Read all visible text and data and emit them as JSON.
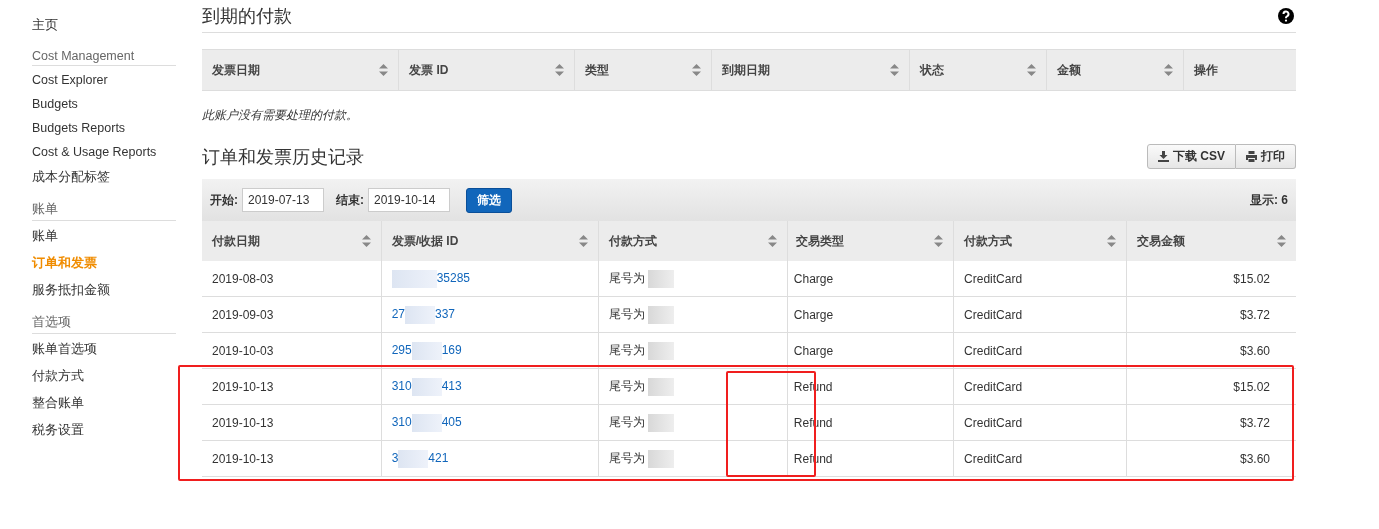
{
  "sidebar": {
    "sections": [
      {
        "items": [
          {
            "label": "主页",
            "selected": false
          }
        ]
      },
      {
        "heading": "Cost Management",
        "items": [
          {
            "label": "Cost Explorer",
            "selected": false
          },
          {
            "label": "Budgets",
            "selected": false
          },
          {
            "label": "Budgets Reports",
            "selected": false
          },
          {
            "label": "Cost & Usage Reports",
            "selected": false
          },
          {
            "label": "成本分配标签",
            "selected": false
          }
        ]
      },
      {
        "heading": "账单",
        "items": [
          {
            "label": "账单",
            "selected": false
          },
          {
            "label": "订单和发票",
            "selected": true
          },
          {
            "label": "服务抵扣金额",
            "selected": false
          }
        ]
      },
      {
        "heading": "首选项",
        "items": [
          {
            "label": "账单首选项",
            "selected": false
          },
          {
            "label": "付款方式",
            "selected": false
          },
          {
            "label": "整合账单",
            "selected": false
          },
          {
            "label": "税务设置",
            "selected": false
          }
        ]
      }
    ]
  },
  "due_payments": {
    "title": "到期的付款",
    "columns": [
      {
        "label": "发票日期",
        "sortable": true
      },
      {
        "label": "发票 ID",
        "sortable": true
      },
      {
        "label": "类型",
        "sortable": true
      },
      {
        "label": "到期日期",
        "sortable": true
      },
      {
        "label": "状态",
        "sortable": true
      },
      {
        "label": "金额",
        "sortable": true
      },
      {
        "label": "操作",
        "sortable": false
      }
    ],
    "empty_message": "此账户没有需要处理的付款。"
  },
  "history": {
    "title": "订单和发票历史记录",
    "buttons": [
      {
        "label": "下载 CSV",
        "kind": "download"
      },
      {
        "label": "打印",
        "kind": "print"
      }
    ],
    "filter": {
      "start_label": "开始:",
      "start_value": "2019-07-13",
      "end_label": "结束:",
      "end_value": "2019-10-14",
      "button": "筛选",
      "count": "显示: 6"
    },
    "columns": [
      {
        "label": "付款日期",
        "sortable": true
      },
      {
        "label": "发票/收据 ID",
        "sortable": true
      },
      {
        "label": "付款方式",
        "sortable": true
      },
      {
        "label": "交易类型",
        "sortable": true
      },
      {
        "label": "付款方式",
        "sortable": true
      },
      {
        "label": "交易金额",
        "sortable": true
      }
    ],
    "rows": [
      {
        "date": "2019-08-03",
        "id_start": null,
        "id_end": "35285",
        "card": "尾号为",
        "type": "Charge",
        "method": "CreditCard",
        "amount": "$15.02",
        "highlighted": false
      },
      {
        "date": "2019-09-03",
        "id_start": "27",
        "id_end": "337",
        "card": "尾号为",
        "type": "Charge",
        "method": "CreditCard",
        "amount": "$3.72",
        "highlighted": false
      },
      {
        "date": "2019-10-03",
        "id_start": "295",
        "id_end": "169",
        "card": "尾号为",
        "type": "Charge",
        "method": "CreditCard",
        "amount": "$3.60",
        "highlighted": false
      },
      {
        "date": "2019-10-13",
        "id_start": "310",
        "id_end": "413",
        "card": "尾号为",
        "type": "Refund",
        "method": "CreditCard",
        "amount": "$15.02",
        "highlighted": true
      },
      {
        "date": "2019-10-13",
        "id_start": "310",
        "id_end": "405",
        "card": "尾号为",
        "type": "Refund",
        "method": "CreditCard",
        "amount": "$3.72",
        "highlighted": true
      },
      {
        "date": "2019-10-13",
        "id_start": "3",
        "id_end": "421",
        "card": "尾号为",
        "type": "Refund",
        "method": "CreditCard",
        "amount": "$3.60",
        "highlighted": true
      }
    ]
  }
}
